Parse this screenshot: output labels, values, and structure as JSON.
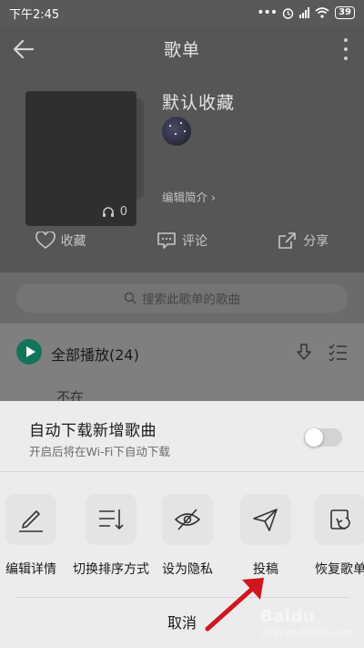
{
  "status_bar": {
    "time": "下午2:45",
    "battery": "39"
  },
  "header": {
    "title": "歌单"
  },
  "playlist": {
    "name": "默认收藏",
    "play_count": "0",
    "edit_intro": "编辑简介"
  },
  "actions": {
    "collect": "收藏",
    "comment": "评论",
    "share": "分享"
  },
  "search": {
    "placeholder": "搜索此歌单的歌曲"
  },
  "list": {
    "play_all": "全部播放(24)",
    "song_peek": "不在"
  },
  "sheet": {
    "auto_download_title": "自动下载新增歌曲",
    "auto_download_subtitle": "开启后将在Wi-Fi下自动下载",
    "toggle_on": false,
    "options": [
      {
        "label": "编辑详情",
        "icon": "edit-icon"
      },
      {
        "label": "切换排序方式",
        "icon": "sort-icon"
      },
      {
        "label": "设为隐私",
        "icon": "eye-off-icon"
      },
      {
        "label": "投稿",
        "icon": "send-icon"
      },
      {
        "label": "恢复歌单",
        "icon": "restore-icon"
      }
    ],
    "cancel": "取消"
  },
  "watermark": {
    "brand": "Baidu",
    "sub": "jingyan.baidu.com"
  },
  "colors": {
    "accent_green": "#14745b",
    "arrow_red": "#d0161e"
  }
}
